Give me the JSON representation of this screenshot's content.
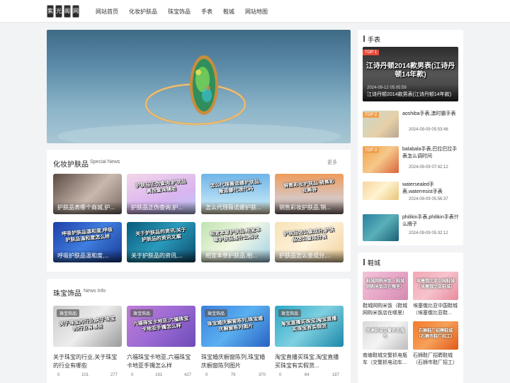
{
  "logo": {
    "chars": [
      "紫",
      "光",
      "阁",
      "网"
    ]
  },
  "nav": {
    "items": [
      "网站首页",
      "化妆护肤品",
      "珠宝饰品",
      "手表",
      "鞋城",
      "网站地图"
    ]
  },
  "makeup": {
    "title": "化妆护肤品",
    "subtitle": "Special News",
    "more": "更多",
    "items": [
      {
        "caption": "护肤品表哪个商城,护...",
        "art": "",
        "bg": "linear-gradient(135deg,#5a4b44,#c9b8ad 55%,#7a6a62)"
      },
      {
        "caption": "护肤品正伪查询,护...",
        "art": "护肤品正伪查询,护肤品真伪查询辅助",
        "bg": "linear-gradient(160deg,#f3d6e7,#d9b5f0 60%,#b7c6f5)"
      },
      {
        "caption": "怎么代理薇诺娜护肤...",
        "art": "怎么代理薇诺娜护肤品,薇诺娜代理代码",
        "bg": "linear-gradient(180deg,#6fb4e8,#b7e0f5 70%,#e9d9b8)"
      },
      {
        "caption": "销售彩妆护肤品,销...",
        "art": "销售彩妆护肤品,销售彩妆美容",
        "bg": "linear-gradient(180deg,#ef9b5a,#d8c6c1 60%,#8e7c78)"
      },
      {
        "caption": "呼吸护肤品温和度,...",
        "art": "呼吸护肤品温和度,呼吸护肤品温和度怎么样",
        "bg": "linear-gradient(135deg,#1e3fa8,#3f7ee0 50%,#1a3b96)"
      },
      {
        "caption": "关于护肤品的资讯,...",
        "art": "关于护肤品的资讯,关于护肤品的资讯文案",
        "bg": "linear-gradient(135deg,#0a5a7a,#2a9bbd 50%,#0c4a6a)"
      },
      {
        "caption": "相宜本草护肤品,相...",
        "art": "相宜本草护肤品,相宜本草护肤品是什么档次",
        "bg": "linear-gradient(135deg,#bfe3b1,#f2f7e4 50%,#9fd0e8)"
      },
      {
        "caption": "护肤品怎么查成分,...",
        "art": "护肤品怎么查成分,护肤品怎么查成分表",
        "bg": "linear-gradient(135deg,#f6e2b8,#fff3dc 50%,#f0cf98)"
      }
    ]
  },
  "jewelry": {
    "title": "珠宝饰品",
    "subtitle": "News Info",
    "items": [
      {
        "tag": "珠宝饰品",
        "title": "关于珠宝的行业,关于珠宝的行业有哪些",
        "art": "关于珠宝的行业,关于珠宝的行业有哪些",
        "views": "0",
        "likes": "101",
        "count": "277",
        "bg": "linear-gradient(135deg,#c9c9c9,#ededed 50%,#9a9a9a)"
      },
      {
        "tag": "珠宝饰品",
        "title": "六福珠宝卡地亚,六福珠宝卡地亚手镯怎么样",
        "art": "六福珠宝卡地亚,六福珠宝卡地亚手镯怎么样",
        "views": "0",
        "likes": "191",
        "count": "427",
        "bg": "linear-gradient(135deg,#c07dd6,#9b6ad3 50%,#6d4bb8)"
      },
      {
        "tag": "珠宝饰品",
        "title": "珠宝婚庆橱窗陈列,珠宝婚庆橱窗陈列图片",
        "art": "珠宝婚庆橱窗陈列,珠宝婚庆橱窗陈列图片",
        "views": "0",
        "likes": "79",
        "count": "370",
        "bg": "linear-gradient(135deg,#3b7fe0,#5ab0f0 50%,#2a62c4)"
      },
      {
        "tag": "珠宝饰品",
        "title": "淘宝直播买珠宝,淘宝直播买珠宝有实假货...",
        "art": "淘宝直播买珠宝,淘宝直播买珠宝有实假货",
        "views": "0",
        "likes": "64",
        "count": "187",
        "bg": "linear-gradient(135deg,#2aa8c8,#7fd0e0 50%,#1b88a8)"
      }
    ]
  },
  "watches": {
    "title": "手表",
    "top": {
      "rank": "TOP 1",
      "title": "江诗丹顿2014款男表(江诗丹顿14年款)",
      "art": "江诗丹顿2014款男表(江诗丹顿14年款)",
      "date": "2024-09-12 05:05:59"
    },
    "items": [
      {
        "rank": "TOP 2",
        "title": "aoshiba手表,澳时霸手表",
        "date": "2024-09-09 05:53:46",
        "color": "#f0a050",
        "bg": "linear-gradient(135deg,#c7d7c9,#e6d0a8 60%,#b8a692)"
      },
      {
        "rank": "TOP 3",
        "title": "balabala手表,巴拉巴拉手表怎么调时间",
        "date": "2024-09-09 07:42:12",
        "color": "#f0a050",
        "bg": "linear-gradient(135deg,#f0a24a,#f6c88a 50%,#d8643a)"
      },
      {
        "rank": "",
        "title": "watersealed手表,waterresist手表",
        "date": "2024-09-09 05:56:37",
        "color": "",
        "bg": "linear-gradient(135deg,#f6d6a0,#fff3d0 50%,#e8c47a)"
      },
      {
        "rank": "",
        "title": "philikin手表,philikin手表什么牌子",
        "date": "2024-09-09 05:32:12",
        "color": "",
        "bg": "linear-gradient(135deg,#2a7fa0,#5ab0b8 50%,#1a5f78)"
      }
    ]
  },
  "shoes": {
    "title": "鞋城",
    "items": [
      {
        "title": "鞋城网购米饭（鞋城网购米饭店在哪里）",
        "art": "鞋城网购米饭（鞋城网购米饭店在哪里）",
        "bg": "linear-gradient(135deg,#f4c4d8,#e8a8c8 50%,#d58ab0)"
      },
      {
        "title": "埃塞俄比亚中国鞋城（埃塞俄比亚鞋...",
        "art": "埃塞俄比亚中国鞋城（埃塞俄比亚鞋城）",
        "bg": "linear-gradient(135deg,#f2a5b5,#f6c3cc 50%,#e88a9e)"
      },
      {
        "title": "南塘鞋城交警抓电瓶车（交警抓电动车...",
        "art": "南塘鞋城交警抓电瓶车",
        "bg": "linear-gradient(135deg,#d8d8d8,#f4f4f4 50%,#bcbcbc)"
      },
      {
        "title": "石狮鞋厂招聘鞋城（石狮市鞋厂招工）",
        "art": "石狮鞋厂招聘鞋城（石狮市鞋厂招工）",
        "bg": "linear-gradient(135deg,#f47a2a,#f6a05a 50%,#e05a18)"
      }
    ]
  }
}
